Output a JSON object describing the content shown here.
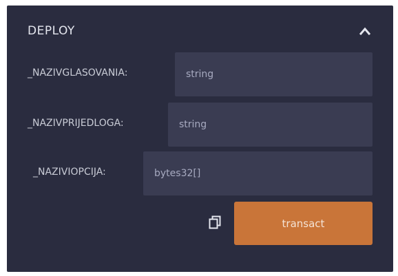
{
  "panel": {
    "title": "DEPLOY",
    "collapse_icon": "chevron-up-icon",
    "colors": {
      "background": "#2a2c3f",
      "input_background": "#3a3c52",
      "accent": "#c97539"
    }
  },
  "params": [
    {
      "label": "_NAZIVGLASOVANIA:",
      "placeholder": "string",
      "value": ""
    },
    {
      "label": "_NAZIVPRIJEDLOGA:",
      "placeholder": "string",
      "value": ""
    },
    {
      "label": "_NAZIVIOPCIJA:",
      "placeholder": "bytes32[]",
      "value": ""
    }
  ],
  "actions": {
    "copy_icon": "copy-icon",
    "transact_label": "transact"
  }
}
